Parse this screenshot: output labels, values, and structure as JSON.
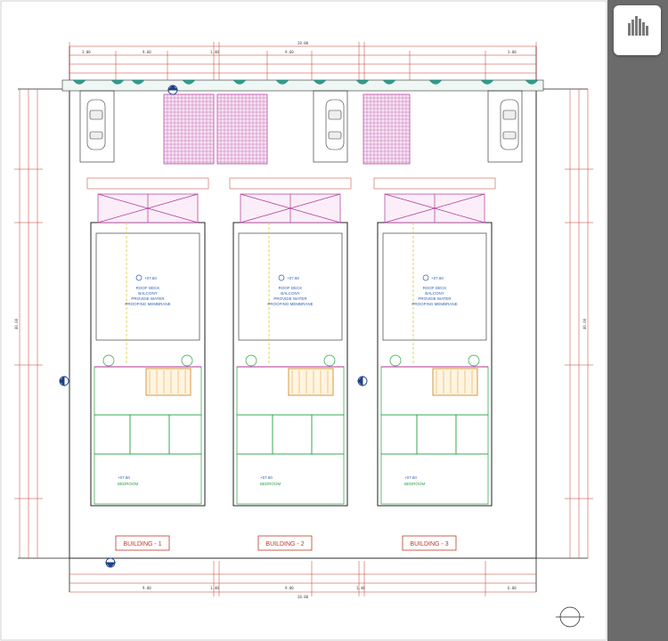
{
  "buildings": [
    {
      "label": "BUILDING - 1",
      "room_labels": [
        "ROOF DECK",
        "BALCONY",
        "PROVIDE WATER",
        "PROOFING MEMBRANE"
      ],
      "lower_room": "BEDROOM",
      "level": "+07.60",
      "stair_level": "+07.60"
    },
    {
      "label": "BUILDING - 2",
      "room_labels": [
        "ROOF DECK",
        "BALCONY",
        "PROVIDE WATER",
        "PROOFING MEMBRANE"
      ],
      "lower_room": "BEDROOM",
      "level": "+07.60",
      "stair_level": "+07.60"
    },
    {
      "label": "BUILDING - 3",
      "room_labels": [
        "ROOF DECK",
        "BALCONY",
        "PROVIDE WATER",
        "PROOFING MEMBRANE"
      ],
      "lower_room": "BEDROOM",
      "level": "+07.60",
      "stair_level": "+07.60"
    }
  ],
  "dimensions": {
    "top_total": "28.00",
    "top_segments": [
      "3.00",
      "9.60",
      "1.40",
      "9.60",
      "3.00"
    ],
    "bottom_total": "28.00",
    "bottom_segments": [
      "9.00",
      "1.40",
      "9.00",
      "1.40",
      "6.00"
    ],
    "left_total": "40.00",
    "right_total": "40.00"
  },
  "colors": {
    "outline": "#1a1a1a",
    "red_lines": "#c0392b",
    "green_lines": "#27a040",
    "blue_lines": "#2f5fb0",
    "magenta": "#b0339b",
    "yellow_dash": "#d6cc2a",
    "teal_fill": "#2e9e8a",
    "sidebar": "#6b6b6b"
  },
  "icons": [
    "car-icon",
    "compass-north-icon",
    "section-marker-icon",
    "logo-icon"
  ]
}
